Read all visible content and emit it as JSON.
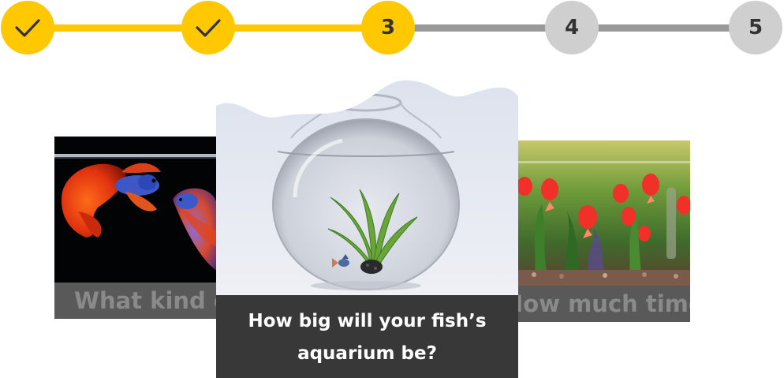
{
  "stepper": {
    "steps": [
      {
        "label": "",
        "status": "completed",
        "icon": "checkmark-icon"
      },
      {
        "label": "",
        "status": "completed",
        "icon": "checkmark-icon"
      },
      {
        "label": "3",
        "status": "current"
      },
      {
        "label": "4",
        "status": "upcoming"
      },
      {
        "label": "5",
        "status": "upcoming"
      }
    ],
    "colors": {
      "active": "#ffc800",
      "inactive": "#cfcfcf",
      "inactive_line": "#999999"
    }
  },
  "cards": {
    "previous": {
      "caption": "What kind of",
      "image": "betta-fish-photo"
    },
    "current": {
      "caption_line1": "How big will your fish’s",
      "caption_line2": "aquarium be?",
      "image": "fishbowl-photo"
    },
    "next": {
      "caption": "How much time",
      "image": "aquarium-tank-photo"
    }
  }
}
